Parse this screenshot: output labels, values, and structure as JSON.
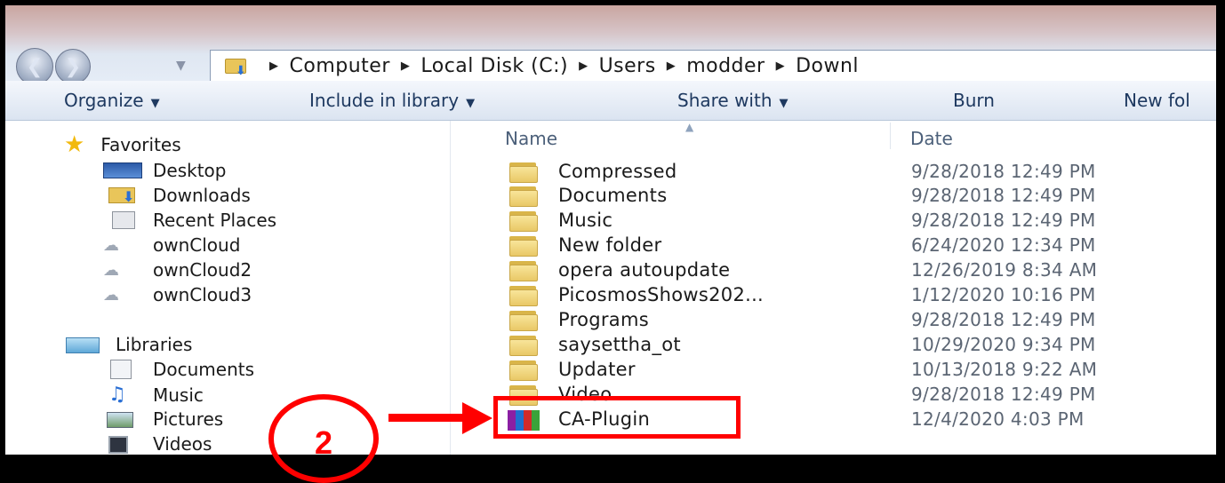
{
  "address": {
    "crumbs": [
      "Computer",
      "Local Disk (C:)",
      "Users",
      "modder",
      "Downl"
    ]
  },
  "toolbar": {
    "organize": "Organize",
    "include": "Include in library",
    "share": "Share with",
    "burn": "Burn",
    "newfolder": "New fol"
  },
  "nav": {
    "favorites": "Favorites",
    "desktop": "Desktop",
    "downloads": "Downloads",
    "recent": "Recent Places",
    "owncloud": "ownCloud",
    "owncloud2": "ownCloud2",
    "owncloud3": "ownCloud3",
    "libraries": "Libraries",
    "documents": "Documents",
    "music": "Music",
    "pictures": "Pictures",
    "videos": "Videos"
  },
  "columns": {
    "name": "Name",
    "date": "Date"
  },
  "files": [
    {
      "name": "Compressed",
      "date": "9/28/2018 12:49 PM",
      "type": "folder"
    },
    {
      "name": "Documents",
      "date": "9/28/2018 12:49 PM",
      "type": "folder"
    },
    {
      "name": "Music",
      "date": "9/28/2018 12:49 PM",
      "type": "folder"
    },
    {
      "name": "New folder",
      "date": "6/24/2020 12:34 PM",
      "type": "folder"
    },
    {
      "name": "opera autoupdate",
      "date": "12/26/2019 8:34 AM",
      "type": "folder"
    },
    {
      "name": "PicosmosShows202...",
      "date": "1/12/2020 10:16 PM",
      "type": "folder"
    },
    {
      "name": "Programs",
      "date": "9/28/2018 12:49 PM",
      "type": "folder"
    },
    {
      "name": "saysettha_ot",
      "date": "10/29/2020 9:34 PM",
      "type": "folder"
    },
    {
      "name": "Updater",
      "date": "10/13/2018 9:22 AM",
      "type": "folder"
    },
    {
      "name": "Video",
      "date": "9/28/2018 12:49 PM",
      "type": "folder"
    },
    {
      "name": "CA-Plugin",
      "date": "12/4/2020 4:03 PM",
      "type": "rar-archive"
    }
  ],
  "annotation": {
    "step": "2",
    "color": "#ff0000"
  }
}
